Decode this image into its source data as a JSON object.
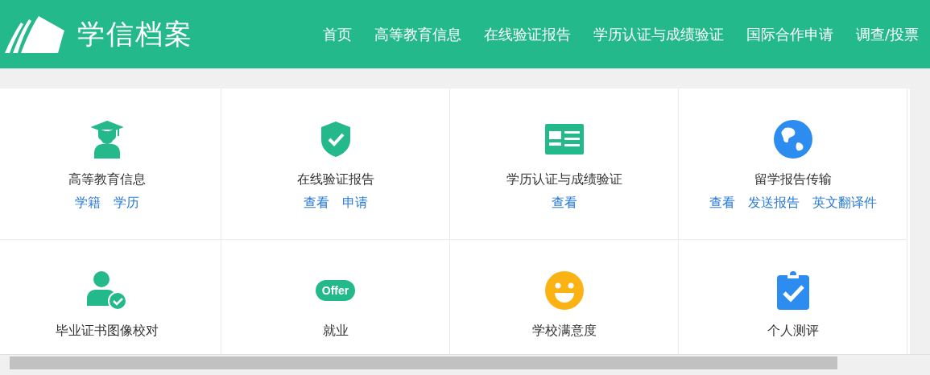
{
  "header": {
    "logo_text": "学信档案",
    "nav": [
      {
        "label": "首页"
      },
      {
        "label": "高等教育信息"
      },
      {
        "label": "在线验证报告"
      },
      {
        "label": "学历认证与成绩验证"
      },
      {
        "label": "国际合作申请"
      },
      {
        "label": "调查/投票"
      }
    ]
  },
  "services": [
    {
      "kind": "graduate",
      "title": "高等教育信息",
      "links": [
        "学籍",
        "学历"
      ]
    },
    {
      "kind": "shield",
      "title": "在线验证报告",
      "links": [
        "查看",
        "申请"
      ]
    },
    {
      "kind": "card",
      "title": "学历认证与成绩验证",
      "links": [
        "查看"
      ]
    },
    {
      "kind": "globe",
      "title": "留学报告传输",
      "links": [
        "查看",
        "发送报告",
        "英文翻译件"
      ]
    },
    {
      "kind": "person-check",
      "title": "毕业证书图像校对"
    },
    {
      "kind": "offer",
      "title": "就业",
      "badge": "Offer"
    },
    {
      "kind": "smile",
      "title": "学校满意度"
    },
    {
      "kind": "clipboard",
      "title": "个人测评"
    }
  ]
}
